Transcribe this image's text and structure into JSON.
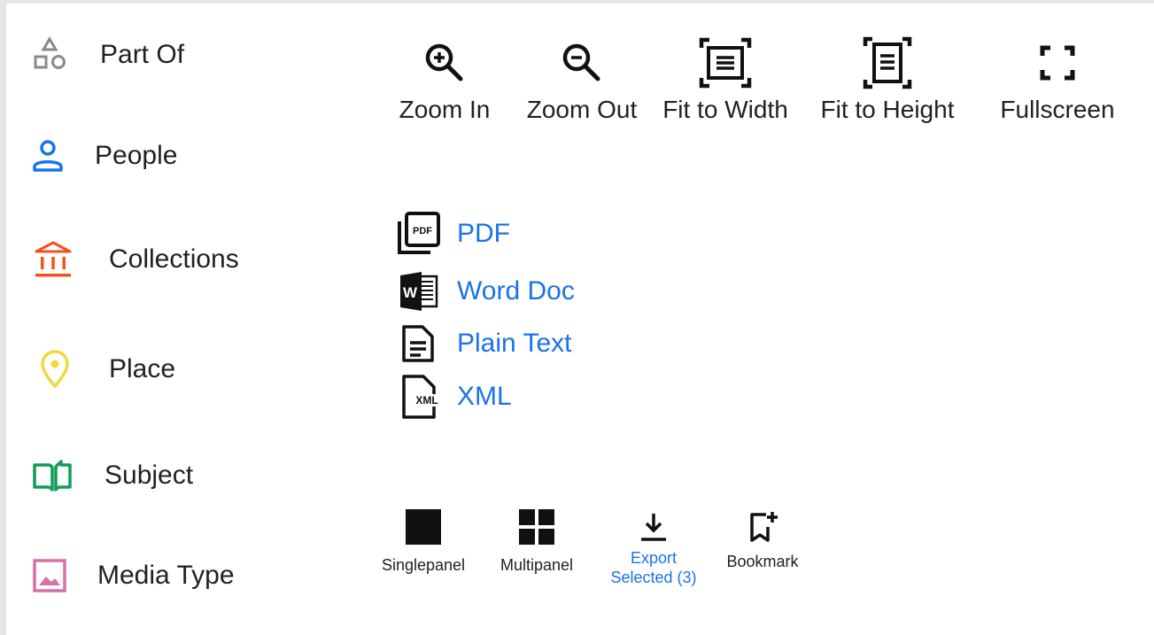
{
  "facets": [
    {
      "label": "Part Of",
      "icon": "shapes-icon",
      "color": "#8a8a8a"
    },
    {
      "label": "People",
      "icon": "person-icon",
      "color": "#1a73e8"
    },
    {
      "label": "Collections",
      "icon": "museum-icon",
      "color": "#f4511e"
    },
    {
      "label": "Place",
      "icon": "location-pin-icon",
      "color": "#f1d93b"
    },
    {
      "label": "Subject",
      "icon": "open-book-icon",
      "color": "#0f9d58"
    },
    {
      "label": "Media Type",
      "icon": "image-icon",
      "color": "#d570a8"
    }
  ],
  "viewer_tools": [
    {
      "label": "Zoom In",
      "icon": "zoom-in-icon"
    },
    {
      "label": "Zoom Out",
      "icon": "zoom-out-icon"
    },
    {
      "label": "Fit to Width",
      "icon": "fit-width-icon"
    },
    {
      "label": "Fit to Height",
      "icon": "fit-height-icon"
    },
    {
      "label": "Fullscreen",
      "icon": "fullscreen-icon"
    }
  ],
  "downloads": [
    {
      "label": "PDF",
      "icon": "pdf-icon",
      "badge": "PDF"
    },
    {
      "label": "Word Doc",
      "icon": "word-doc-icon",
      "badge": "W"
    },
    {
      "label": "Plain Text",
      "icon": "plain-text-icon"
    },
    {
      "label": "XML",
      "icon": "xml-file-icon",
      "badge": "XML"
    }
  ],
  "actions": {
    "singlepanel": {
      "label": "Singlepanel",
      "icon": "single-panel-icon"
    },
    "multipanel": {
      "label": "Multipanel",
      "icon": "multi-panel-icon"
    },
    "export": {
      "label_line1": "Export",
      "label_line2": "Selected (3)",
      "icon": "download-icon"
    },
    "bookmark": {
      "label": "Bookmark",
      "icon": "bookmark-add-icon"
    }
  },
  "colors": {
    "link": "#1a73e8",
    "text": "#202124"
  }
}
